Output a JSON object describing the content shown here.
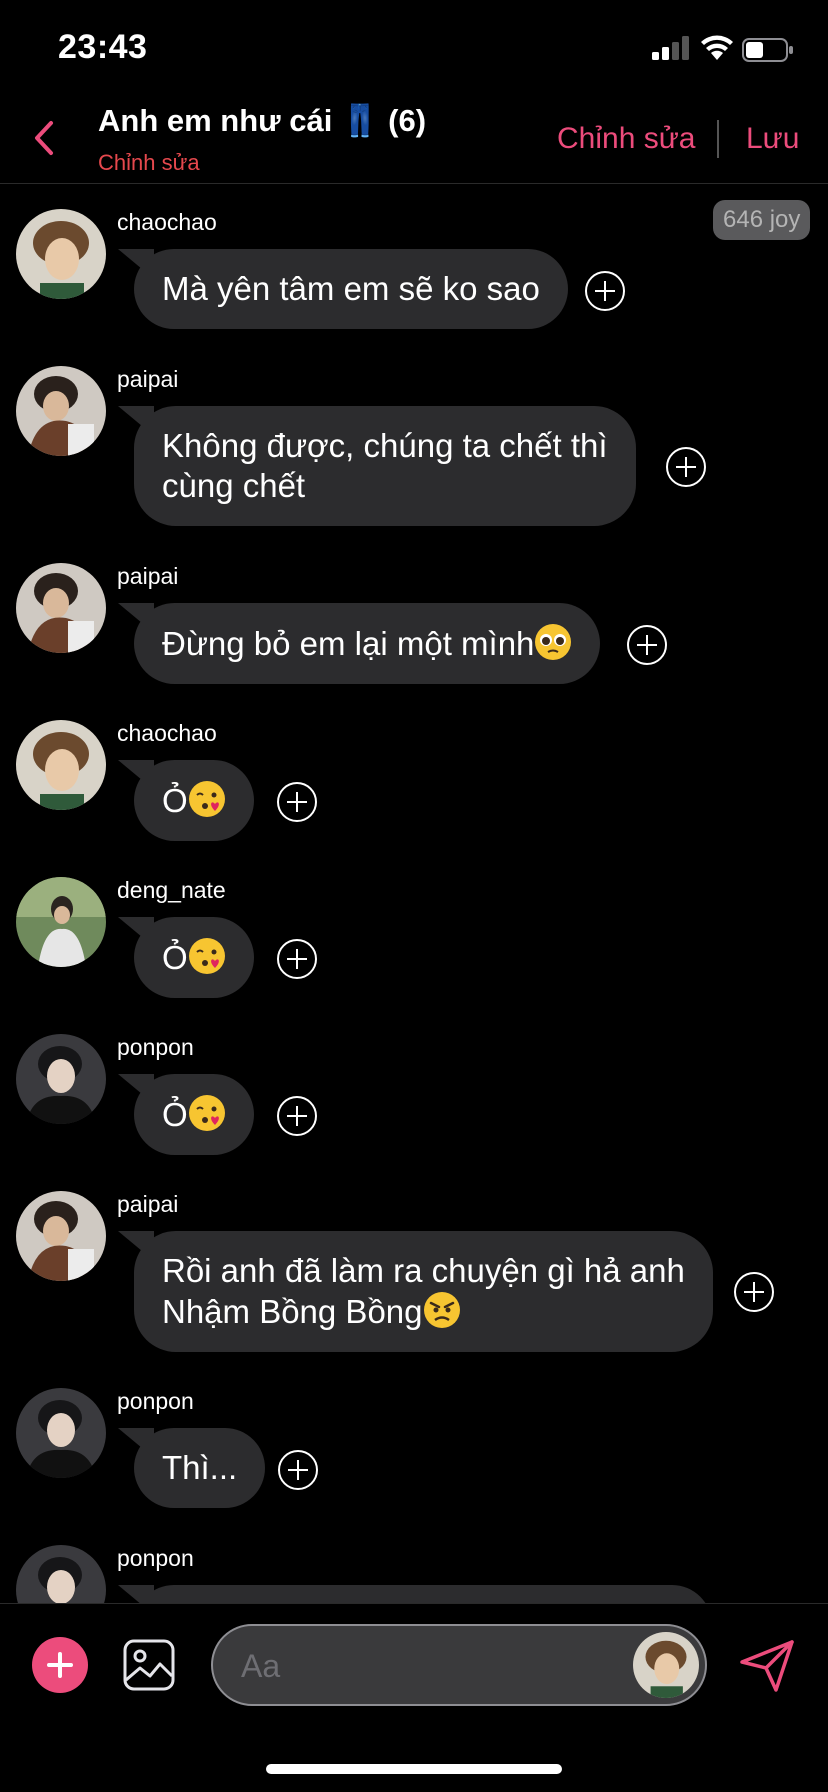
{
  "status_bar": {
    "time": "23:43",
    "battery_level": 0.45
  },
  "header": {
    "title": "Anh em như cái 👖 (6)",
    "subtitle": "Chỉnh sửa",
    "edit_label": "Chỉnh sửa",
    "save_label": "Lưu",
    "accent_color": "#ec4c7c"
  },
  "joy_badge": "646 joy",
  "messages": [
    {
      "sender": "chaochao",
      "text": "Mà yên tâm em sẽ ko sao"
    },
    {
      "sender": "paipai",
      "line1": "Không được, chúng ta chết thì",
      "line2": "cùng chết"
    },
    {
      "sender": "paipai",
      "text": "Đừng bỏ em lại một mình",
      "emoji": "pleading-face"
    },
    {
      "sender": "chaochao",
      "text": "Ỏ",
      "emoji": "kissing-heart"
    },
    {
      "sender": "deng_nate",
      "text": "Ỏ",
      "emoji": "kissing-heart"
    },
    {
      "sender": "ponpon",
      "text": "Ỏ",
      "emoji": "kissing-heart"
    },
    {
      "sender": "paipai",
      "line1": "Rồi anh đã làm ra chuyện gì hả anh",
      "line2": "Nhậm Bồng Bồng",
      "emoji": "angry-face"
    },
    {
      "sender": "ponpon",
      "text": "Thì..."
    },
    {
      "sender": "ponpon",
      "text": ""
    }
  ],
  "input": {
    "placeholder": "Aa"
  },
  "icons": {
    "back": "chevron-left-icon",
    "add": "plus-icon",
    "image": "image-icon",
    "send": "send-icon",
    "reaction": "add-reaction-icon"
  }
}
